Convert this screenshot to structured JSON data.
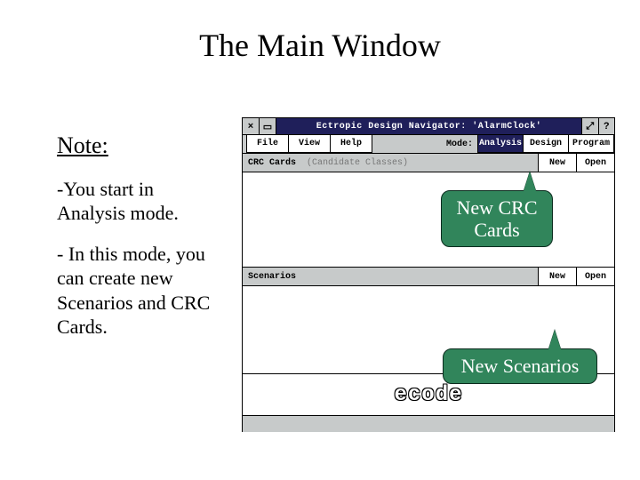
{
  "title": "The Main Window",
  "note": {
    "heading": "Note:",
    "p1": "-You start in Analysis mode.",
    "p2": "- In this mode, you can create new Scenarios and CRC Cards."
  },
  "app": {
    "window_title": "Ectropic Design Navigator: 'AlarmClock'",
    "titlebar": {
      "close": "×",
      "menu": "▭",
      "zoom": "⤢",
      "help": "?"
    },
    "menus": {
      "file": "File",
      "view": "View",
      "help": "Help"
    },
    "mode_label": "Mode:",
    "modes": {
      "analysis": "Analysis",
      "design": "Design",
      "program": "Program"
    },
    "sections": {
      "crc": {
        "title": "CRC Cards",
        "subtitle": "(Candidate Classes)",
        "new": "New",
        "open": "Open"
      },
      "scenarios": {
        "title": "Scenarios",
        "new": "New",
        "open": "Open"
      }
    },
    "footer_logo": "ecode"
  },
  "callouts": {
    "crc": "New CRC Cards",
    "scen": "New Scenarios"
  }
}
